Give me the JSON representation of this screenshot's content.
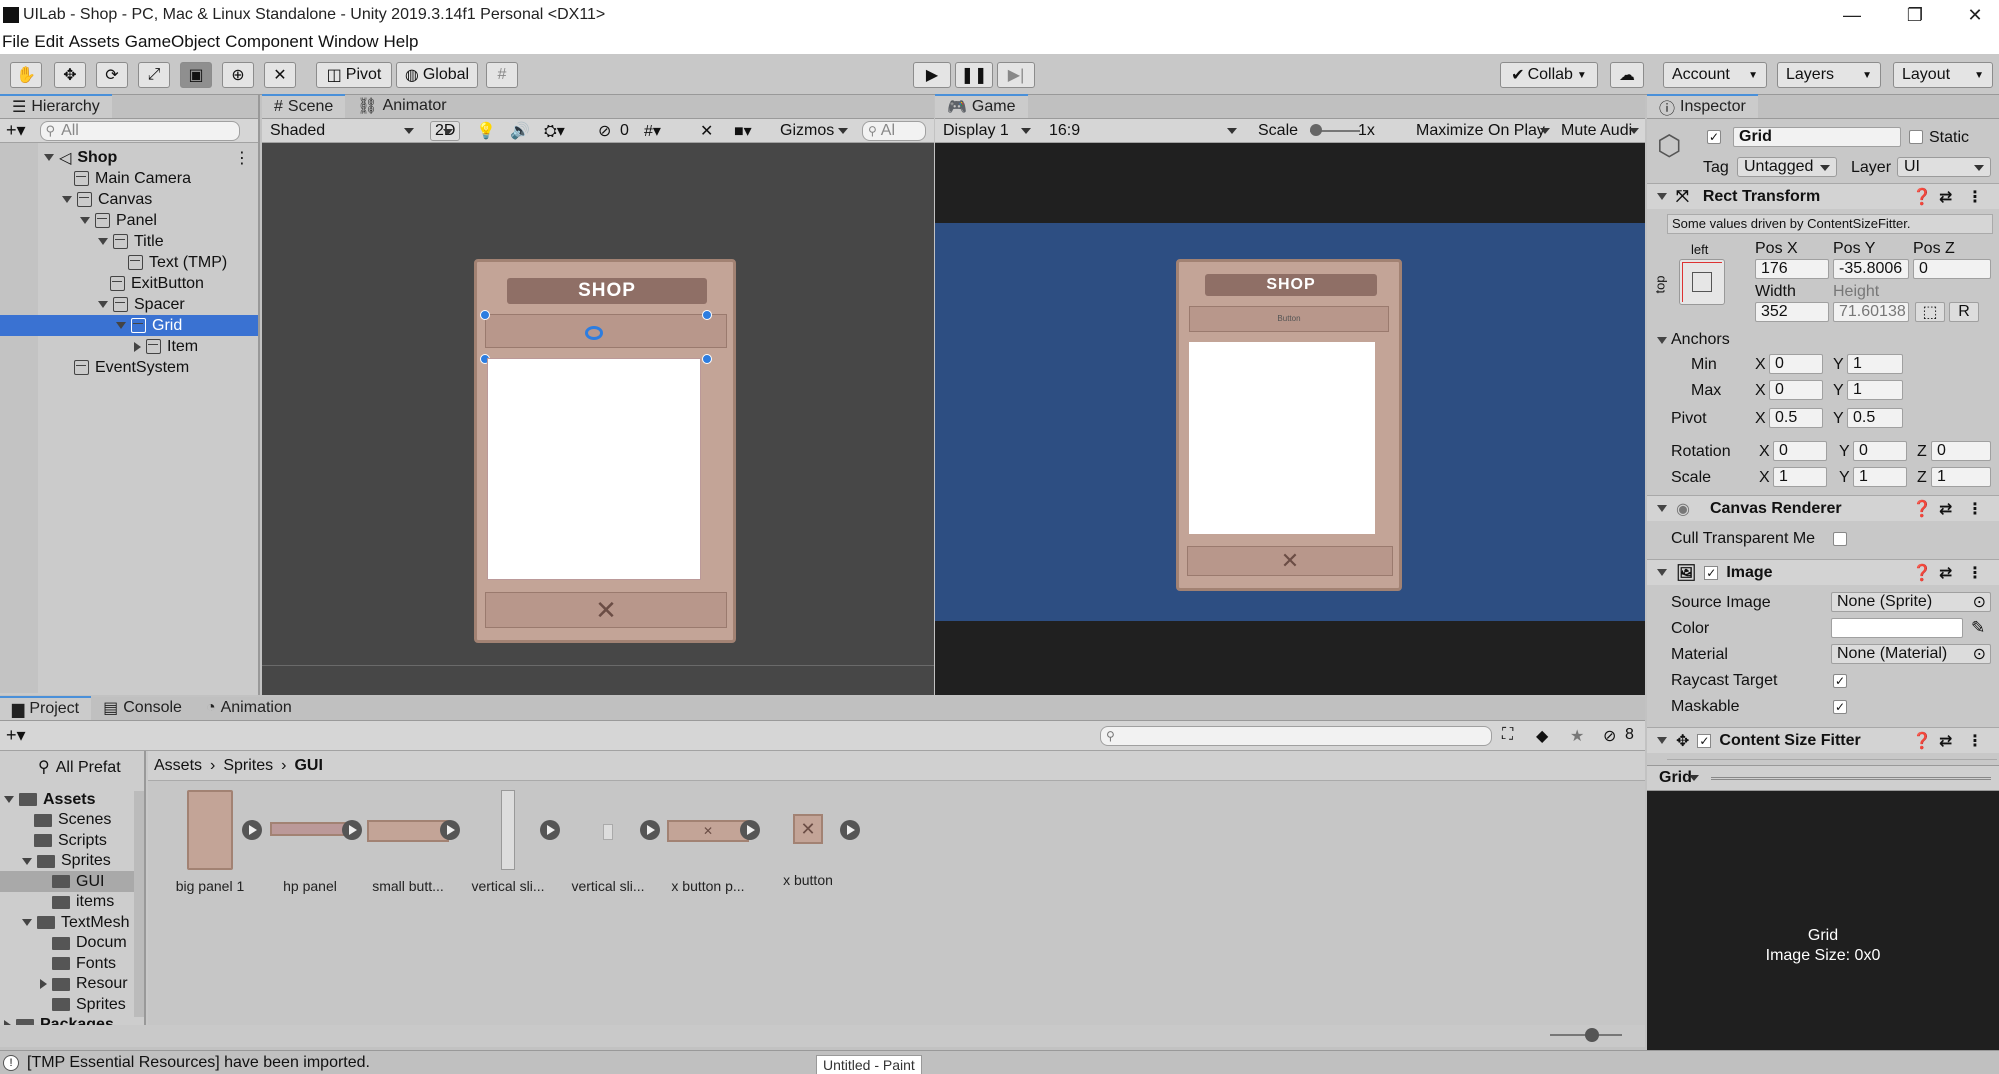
{
  "window": {
    "title": "UILab - Shop - PC, Mac & Linux Standalone - Unity 2019.3.14f1 Personal <DX11>"
  },
  "menu": [
    "File",
    "Edit",
    "Assets",
    "GameObject",
    "Component",
    "Window",
    "Help"
  ],
  "toolbar": {
    "pivot": "Pivot",
    "global": "Global",
    "collab": "Collab",
    "account": "Account",
    "layers": "Layers",
    "layout": "Layout"
  },
  "hierarchy": {
    "tab": "Hierarchy",
    "search_placeholder": "All",
    "items": [
      {
        "label": "Shop",
        "depth": 0,
        "arrow": "d",
        "scene": true
      },
      {
        "label": "Main Camera",
        "depth": 1,
        "arrow": ""
      },
      {
        "label": "Canvas",
        "depth": 1,
        "arrow": "d"
      },
      {
        "label": "Panel",
        "depth": 2,
        "arrow": "d"
      },
      {
        "label": "Title",
        "depth": 3,
        "arrow": "d"
      },
      {
        "label": "Text (TMP)",
        "depth": 4,
        "arrow": ""
      },
      {
        "label": "ExitButton",
        "depth": 3,
        "arrow": ""
      },
      {
        "label": "Spacer",
        "depth": 3,
        "arrow": "d"
      },
      {
        "label": "Grid",
        "depth": 4,
        "arrow": "d",
        "selected": true
      },
      {
        "label": "Item",
        "depth": 5,
        "arrow": "r"
      },
      {
        "label": "EventSystem",
        "depth": 1,
        "arrow": ""
      }
    ]
  },
  "scene": {
    "tab": "Scene",
    "tab2": "Animator",
    "shading": "Shaded",
    "mode2d": "2D",
    "hidden_count": "0",
    "gizmos": "Gizmos",
    "search_placeholder": "Al",
    "shop_title": "SHOP"
  },
  "game": {
    "tab": "Game",
    "display": "Display 1",
    "aspect": "16:9",
    "scale_label": "Scale",
    "scale_value": "1x",
    "maximize": "Maximize On Play",
    "mute": "Mute Audi",
    "shop_title": "SHOP",
    "button_text": "Button"
  },
  "inspector": {
    "tab": "Inspector",
    "name": "Grid",
    "static": "Static",
    "tag_label": "Tag",
    "tag": "Untagged",
    "layer_label": "Layer",
    "layer": "UI",
    "rect": {
      "title": "Rect Transform",
      "note": "Some values driven by ContentSizeFitter.",
      "anchor_h": "left",
      "anchor_v": "top",
      "posx_l": "Pos X",
      "posy_l": "Pos Y",
      "posz_l": "Pos Z",
      "posx": "176",
      "posy": "-35.8006",
      "posz": "0",
      "w_l": "Width",
      "h_l": "Height",
      "w": "352",
      "h": "71.60138",
      "r": "R",
      "anchors": "Anchors",
      "min": "Min",
      "max": "Max",
      "min_x": "0",
      "min_y": "1",
      "max_x": "0",
      "max_y": "1",
      "pivot": "Pivot",
      "pivot_x": "0.5",
      "pivot_y": "0.5",
      "rotation": "Rotation",
      "rot_x": "0",
      "rot_y": "0",
      "rot_z": "0",
      "scale": "Scale",
      "sc_x": "1",
      "sc_y": "1",
      "sc_z": "1",
      "x": "X",
      "y": "Y",
      "z": "Z"
    },
    "canvas_renderer": {
      "title": "Canvas Renderer",
      "cull": "Cull Transparent Me"
    },
    "image": {
      "title": "Image",
      "source_l": "Source Image",
      "source": "None (Sprite)",
      "color_l": "Color",
      "material_l": "Material",
      "material": "None (Material)",
      "raycast": "Raycast Target",
      "maskable": "Maskable"
    },
    "csf": {
      "title": "Content Size Fitter"
    },
    "preview": {
      "drop": "Grid",
      "name": "Grid",
      "size": "Image Size: 0x0"
    }
  },
  "project": {
    "tabs": [
      "Project",
      "Console",
      "Animation"
    ],
    "hidden_count": "8",
    "favorites": "All Prefat",
    "breadcrumb": [
      "Assets",
      "Sprites",
      "GUI"
    ],
    "tree": [
      {
        "label": "Assets",
        "depth": 0,
        "arrow": "d",
        "bold": true
      },
      {
        "label": "Scenes",
        "depth": 1,
        "arrow": ""
      },
      {
        "label": "Scripts",
        "depth": 1,
        "arrow": ""
      },
      {
        "label": "Sprites",
        "depth": 1,
        "arrow": "d"
      },
      {
        "label": "GUI",
        "depth": 2,
        "arrow": "",
        "selected": true
      },
      {
        "label": "items",
        "depth": 2,
        "arrow": ""
      },
      {
        "label": "TextMesh",
        "depth": 1,
        "arrow": "d"
      },
      {
        "label": "Docum",
        "depth": 2,
        "arrow": ""
      },
      {
        "label": "Fonts",
        "depth": 2,
        "arrow": ""
      },
      {
        "label": "Resour",
        "depth": 2,
        "arrow": "r"
      },
      {
        "label": "Sprites",
        "depth": 2,
        "arrow": ""
      },
      {
        "label": "Packages",
        "depth": 0,
        "arrow": "r",
        "bold": true
      }
    ],
    "assets": [
      "big panel 1",
      "hp panel",
      "small butt...",
      "vertical sli...",
      "vertical sli...",
      "x button p...",
      "x button"
    ]
  },
  "status": {
    "message": "[TMP Essential Resources] have been imported.",
    "taskbar": "Untitled - Paint"
  },
  "colors": {
    "selection": "#3a72d2",
    "game_bg": "#2d4e82",
    "scene_bg": "#474747",
    "panel_frame": "#c3a497"
  }
}
